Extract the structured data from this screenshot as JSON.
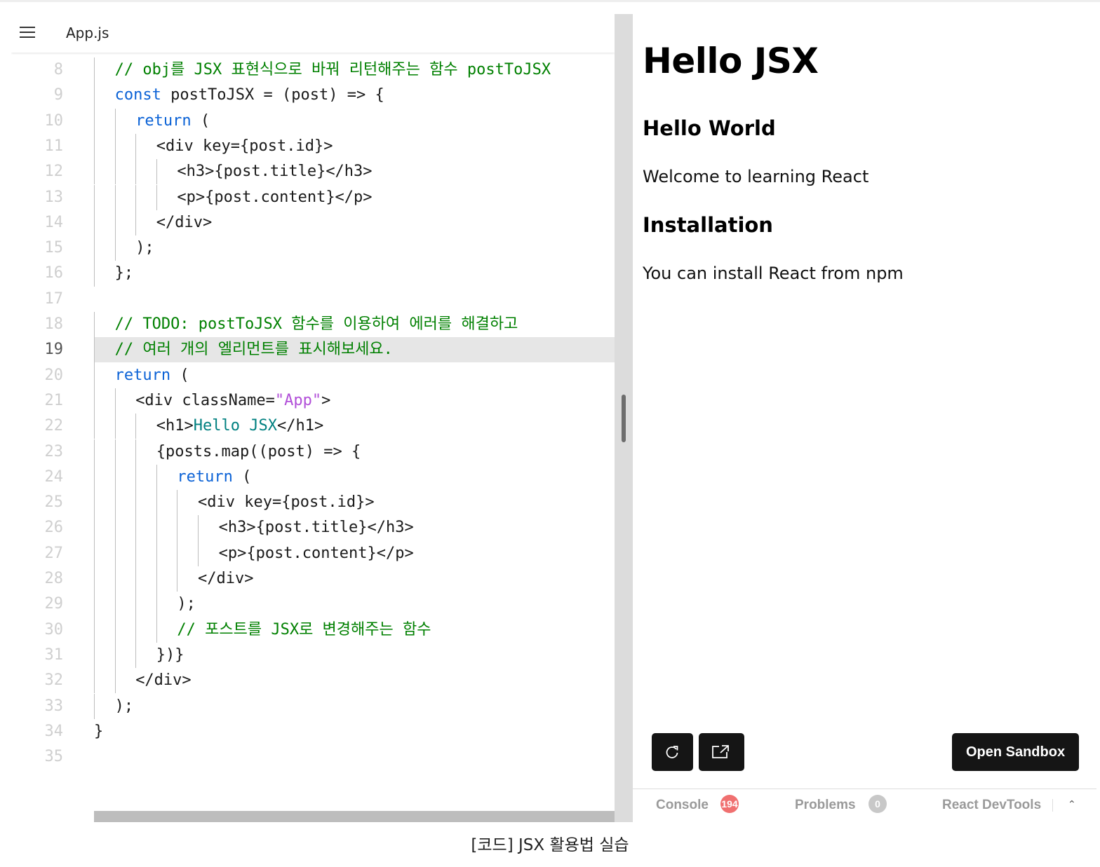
{
  "editor": {
    "tab_label": "App.js",
    "current_line": "19",
    "lines": [
      {
        "num": "8",
        "indent": 2,
        "segs": [
          {
            "t": "// obj를 JSX 표현식으로 바꿔 리턴해주는 함수 postToJSX",
            "c": "cm"
          }
        ]
      },
      {
        "num": "9",
        "indent": 2,
        "segs": [
          {
            "t": "const",
            "c": "kw"
          },
          {
            "t": " postToJSX = (post) => {",
            "c": ""
          }
        ]
      },
      {
        "num": "10",
        "indent": 4,
        "segs": [
          {
            "t": "return",
            "c": "kw"
          },
          {
            "t": " (",
            "c": ""
          }
        ]
      },
      {
        "num": "11",
        "indent": 6,
        "segs": [
          {
            "t": "<div key={post.id}>",
            "c": ""
          }
        ]
      },
      {
        "num": "12",
        "indent": 8,
        "segs": [
          {
            "t": "<h3>{post.title}</h3>",
            "c": ""
          }
        ]
      },
      {
        "num": "13",
        "indent": 8,
        "segs": [
          {
            "t": "<p>{post.content}</p>",
            "c": ""
          }
        ]
      },
      {
        "num": "14",
        "indent": 6,
        "segs": [
          {
            "t": "</div>",
            "c": ""
          }
        ]
      },
      {
        "num": "15",
        "indent": 4,
        "segs": [
          {
            "t": ");",
            "c": ""
          }
        ]
      },
      {
        "num": "16",
        "indent": 2,
        "segs": [
          {
            "t": "};",
            "c": ""
          }
        ]
      },
      {
        "num": "17",
        "indent": 0,
        "segs": []
      },
      {
        "num": "18",
        "indent": 2,
        "segs": [
          {
            "t": "// TODO: postToJSX 함수를 이용하여 에러를 해결하고",
            "c": "cm"
          }
        ]
      },
      {
        "num": "19",
        "indent": 2,
        "segs": [
          {
            "t": "// 여러 개의 엘리먼트를 표시해보세요.",
            "c": "cm"
          }
        ]
      },
      {
        "num": "20",
        "indent": 2,
        "segs": [
          {
            "t": "return",
            "c": "kw"
          },
          {
            "t": " (",
            "c": ""
          }
        ]
      },
      {
        "num": "21",
        "indent": 4,
        "segs": [
          {
            "t": "<div className=",
            "c": ""
          },
          {
            "t": "\"App\"",
            "c": "str"
          },
          {
            "t": ">",
            "c": ""
          }
        ]
      },
      {
        "num": "22",
        "indent": 6,
        "segs": [
          {
            "t": "<h1>",
            "c": ""
          },
          {
            "t": "Hello JSX",
            "c": "tx"
          },
          {
            "t": "</h1>",
            "c": ""
          }
        ]
      },
      {
        "num": "23",
        "indent": 6,
        "segs": [
          {
            "t": "{posts.map((post) => {",
            "c": ""
          }
        ]
      },
      {
        "num": "24",
        "indent": 8,
        "segs": [
          {
            "t": "return",
            "c": "kw"
          },
          {
            "t": " (",
            "c": ""
          }
        ]
      },
      {
        "num": "25",
        "indent": 10,
        "segs": [
          {
            "t": "<div key={post.id}>",
            "c": ""
          }
        ]
      },
      {
        "num": "26",
        "indent": 12,
        "segs": [
          {
            "t": "<h3>{post.title}</h3>",
            "c": ""
          }
        ]
      },
      {
        "num": "27",
        "indent": 12,
        "segs": [
          {
            "t": "<p>{post.content}</p>",
            "c": ""
          }
        ]
      },
      {
        "num": "28",
        "indent": 10,
        "segs": [
          {
            "t": "</div>",
            "c": ""
          }
        ]
      },
      {
        "num": "29",
        "indent": 8,
        "segs": [
          {
            "t": ");",
            "c": ""
          }
        ]
      },
      {
        "num": "30",
        "indent": 8,
        "segs": [
          {
            "t": "// 포스트를 JSX로 변경해주는 함수",
            "c": "cm"
          }
        ]
      },
      {
        "num": "31",
        "indent": 6,
        "segs": [
          {
            "t": "})}",
            "c": ""
          }
        ]
      },
      {
        "num": "32",
        "indent": 4,
        "segs": [
          {
            "t": "</div>",
            "c": ""
          }
        ]
      },
      {
        "num": "33",
        "indent": 2,
        "segs": [
          {
            "t": ");",
            "c": ""
          }
        ]
      },
      {
        "num": "34",
        "indent": 0,
        "segs": [
          {
            "t": "}",
            "c": ""
          }
        ]
      },
      {
        "num": "35",
        "indent": 0,
        "segs": []
      }
    ]
  },
  "preview": {
    "h1": "Hello JSX",
    "posts": [
      {
        "title": "Hello World",
        "content": "Welcome to learning React"
      },
      {
        "title": "Installation",
        "content": "You can install React from npm"
      }
    ],
    "refresh_icon": "refresh-icon",
    "open_new_window_icon": "external-link-icon",
    "open_sandbox_label": "Open Sandbox"
  },
  "status_bar": {
    "console_label": "Console",
    "console_count": "194",
    "problems_label": "Problems",
    "problems_count": "0",
    "devtools_label": "React DevTools"
  },
  "caption": "[코드] JSX 활용법 실습",
  "colors": {
    "comment": "#008000",
    "keyword": "#0b62d6",
    "string": "#b14fd8",
    "jsx_text": "#008080",
    "button_bg": "#151515",
    "console_badge": "#f07070"
  }
}
